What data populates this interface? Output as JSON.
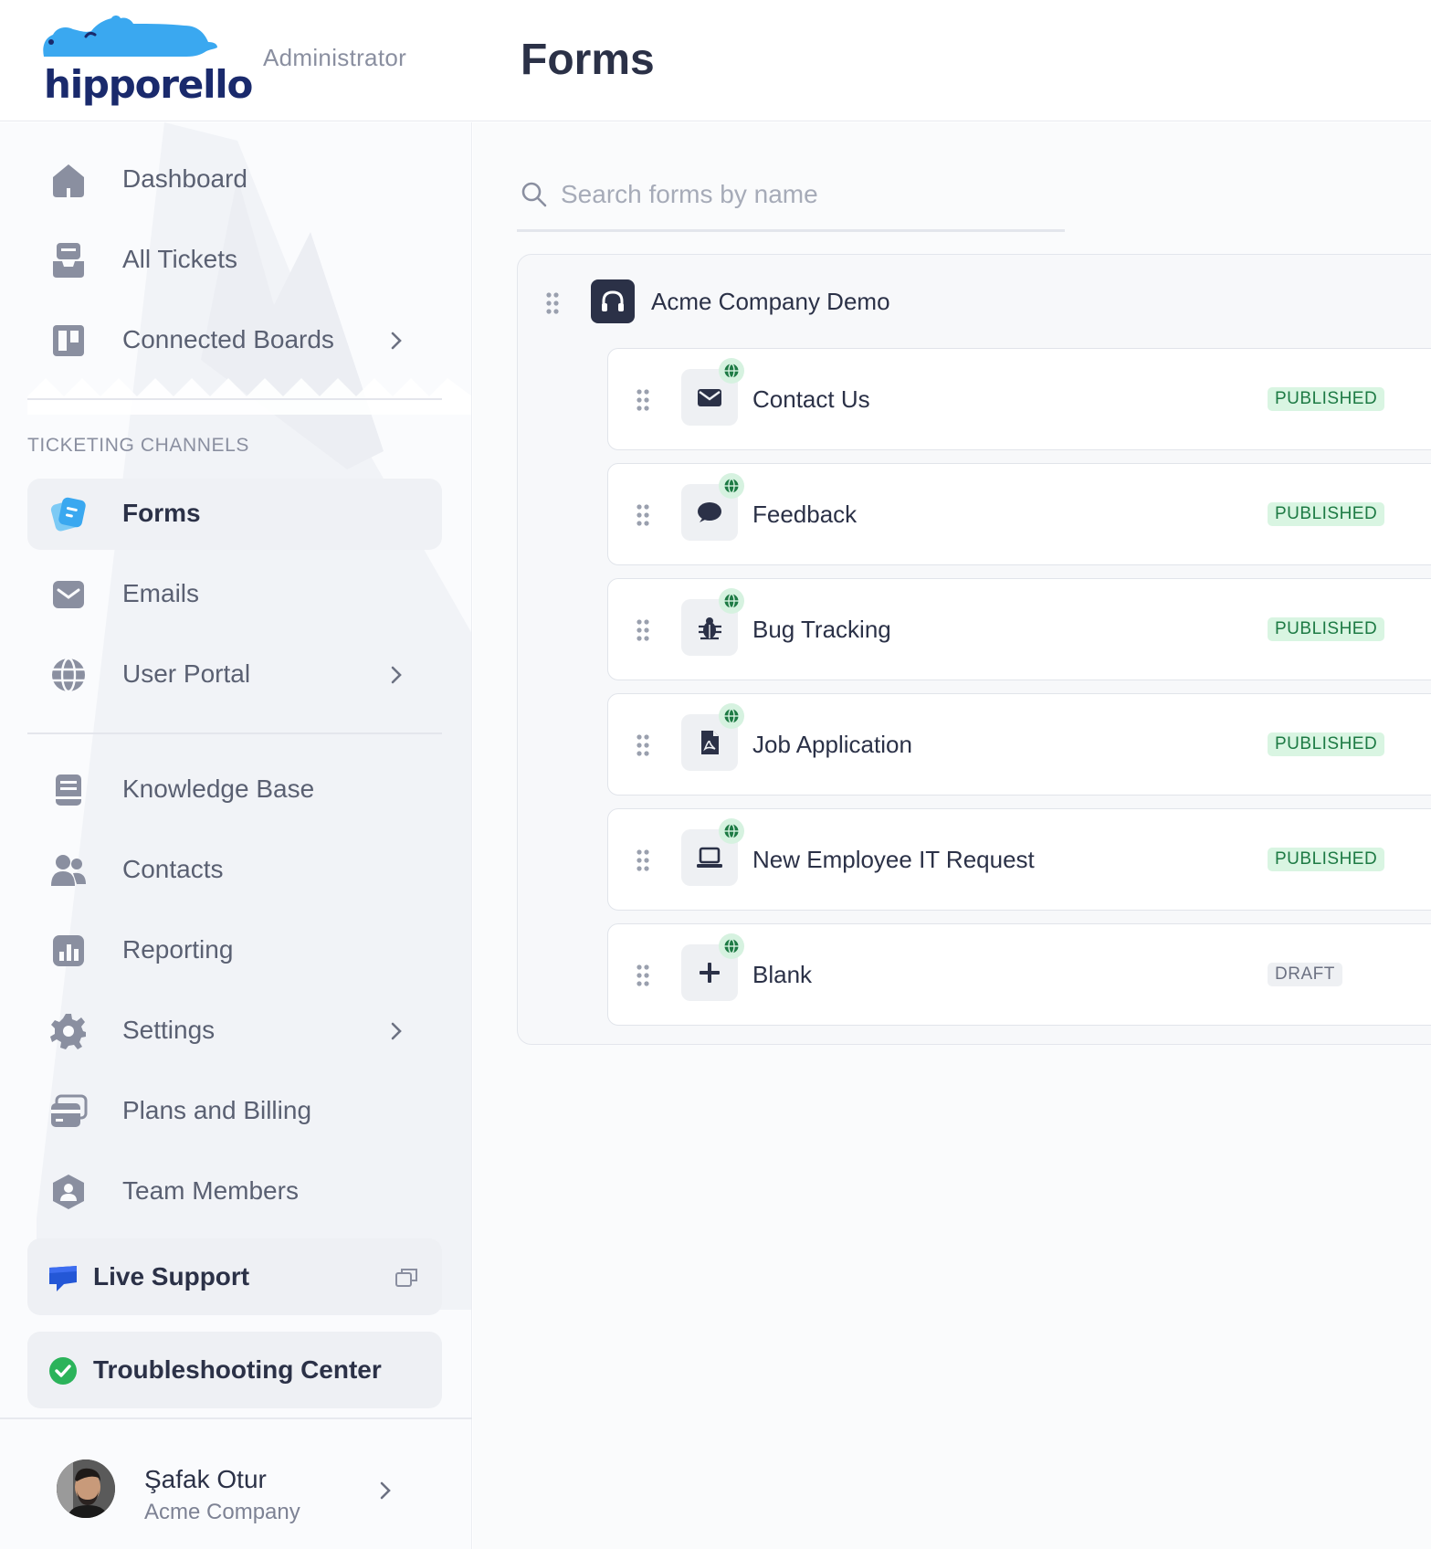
{
  "brand": {
    "logo_text": "hipporello",
    "role": "Administrator",
    "logo_color": "#3aa8f0",
    "logo_text_color": "#1a2a6c"
  },
  "page": {
    "title": "Forms"
  },
  "sidebar": {
    "nav_top": [
      {
        "label": "Dashboard",
        "icon": "home-icon"
      },
      {
        "label": "All Tickets",
        "icon": "tickets-icon"
      },
      {
        "label": "Connected Boards",
        "icon": "boards-icon",
        "has_submenu": true
      }
    ],
    "section_label": "TICKETING CHANNELS",
    "nav_channels": [
      {
        "label": "Forms",
        "icon": "forms-icon",
        "active": true
      },
      {
        "label": "Emails",
        "icon": "mail-icon"
      },
      {
        "label": "User Portal",
        "icon": "globe-icon",
        "has_submenu": true
      }
    ],
    "nav_bottom": [
      {
        "label": "Knowledge Base",
        "icon": "book-icon"
      },
      {
        "label": "Contacts",
        "icon": "contacts-icon"
      },
      {
        "label": "Reporting",
        "icon": "chart-icon"
      },
      {
        "label": "Settings",
        "icon": "gear-icon",
        "has_submenu": true
      },
      {
        "label": "Plans and Billing",
        "icon": "billing-icon"
      },
      {
        "label": "Team Members",
        "icon": "user-icon"
      }
    ],
    "live_support": {
      "label": "Live Support",
      "icon": "chat-bubble-icon"
    },
    "troubleshooting": {
      "label": "Troubleshooting Center",
      "icon": "check-circle-icon"
    },
    "user": {
      "name": "Şafak Otur",
      "company": "Acme Company"
    }
  },
  "search": {
    "placeholder": "Search forms by name",
    "value": ""
  },
  "group": {
    "title": "Acme Company Demo",
    "icon": "headset-icon",
    "forms": [
      {
        "title": "Contact Us",
        "icon": "envelope-icon",
        "status": "PUBLISHED"
      },
      {
        "title": "Feedback",
        "icon": "speech-bubble-icon",
        "status": "PUBLISHED"
      },
      {
        "title": "Bug Tracking",
        "icon": "bug-icon",
        "status": "PUBLISHED"
      },
      {
        "title": "Job Application",
        "icon": "pdf-file-icon",
        "status": "PUBLISHED"
      },
      {
        "title": "New Employee IT Request",
        "icon": "laptop-icon",
        "status": "PUBLISHED"
      },
      {
        "title": "Blank",
        "icon": "plus-icon",
        "status": "DRAFT"
      }
    ]
  },
  "colors": {
    "accent": "#3aa8f0",
    "text": "#2b3147",
    "published_bg": "#d9f5e2",
    "published_text": "#1d7a44",
    "draft_bg": "#eef0f3",
    "success": "#2bb35a",
    "live_support": "#2457d6"
  }
}
